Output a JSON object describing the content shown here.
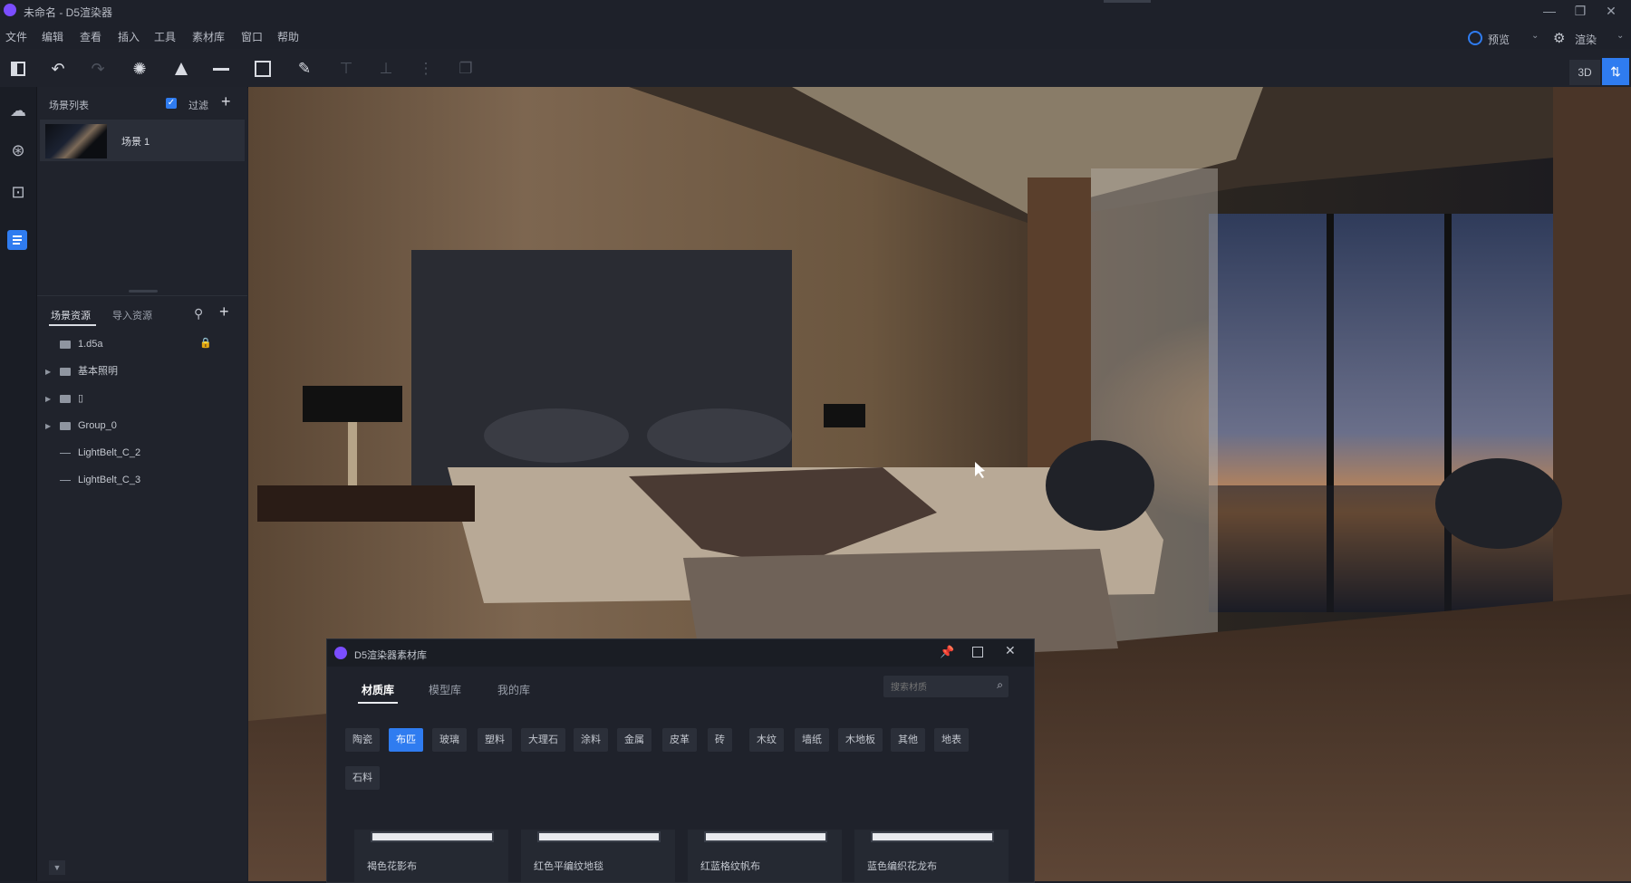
{
  "window": {
    "title": "未命名 - D5渲染器",
    "controls": [
      "—",
      "❐",
      "✕"
    ]
  },
  "menu": [
    "文件",
    "编辑",
    "查看",
    "插入",
    "工具",
    "素材库",
    "窗口",
    "帮助"
  ],
  "toolbar_right": {
    "preview_label": "预览",
    "render_label": "渲染",
    "mode_3d": "3D"
  },
  "scene_list": {
    "header": "场景列表",
    "filter_label": "过滤",
    "scenes": [
      {
        "name": "场景 1"
      }
    ]
  },
  "assets": {
    "tab_scene": "场景资源",
    "tab_import": "导入资源",
    "items": [
      {
        "name": "1.d5a",
        "expandable": false,
        "locked": true
      },
      {
        "name": "基本照明",
        "expandable": true
      },
      {
        "name": "▯",
        "expandable": true
      },
      {
        "name": "Group_0",
        "expandable": true
      },
      {
        "name": "LightBelt_C_2",
        "expandable": false
      },
      {
        "name": "LightBelt_C_3",
        "expandable": false
      }
    ]
  },
  "library": {
    "title": "D5渲染器素材库",
    "tabs": [
      "材质库",
      "模型库",
      "我的库"
    ],
    "active_tab": "材质库",
    "search_placeholder": "搜索材质",
    "categories": [
      "陶瓷",
      "布匹",
      "玻璃",
      "塑料",
      "大理石",
      "涂料",
      "金属",
      "皮革",
      "砖",
      "木纹",
      "墙纸",
      "木地板",
      "其他",
      "地表",
      "石料"
    ],
    "active_category": "布匹",
    "materials": [
      "褐色花影布",
      "红色平编纹地毯",
      "红蓝格纹帆布",
      "蓝色编织花龙布"
    ]
  }
}
